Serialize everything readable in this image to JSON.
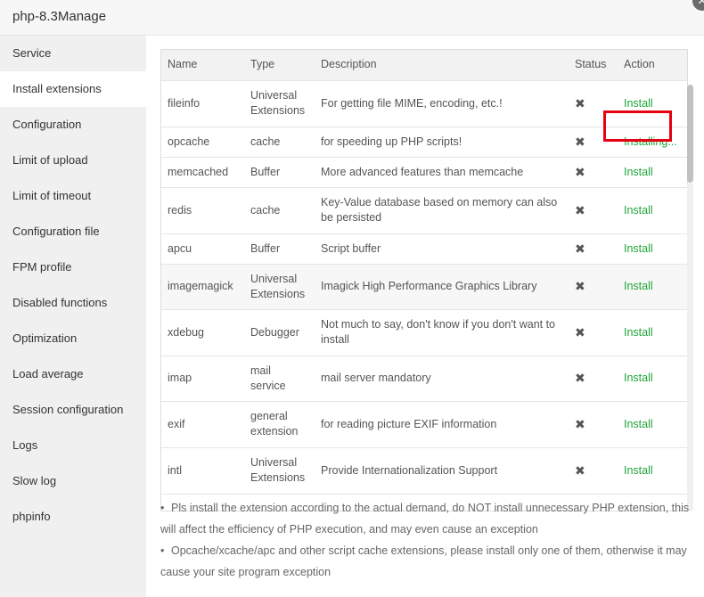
{
  "window": {
    "title": "php-8.3Manage",
    "close_label": "✕"
  },
  "sidebar": {
    "items": [
      {
        "label": "Service"
      },
      {
        "label": "Install extensions"
      },
      {
        "label": "Configuration"
      },
      {
        "label": "Limit of upload"
      },
      {
        "label": "Limit of timeout"
      },
      {
        "label": "Configuration file"
      },
      {
        "label": "FPM profile"
      },
      {
        "label": "Disabled functions"
      },
      {
        "label": "Optimization"
      },
      {
        "label": "Load average"
      },
      {
        "label": "Session configuration"
      },
      {
        "label": "Logs"
      },
      {
        "label": "Slow log"
      },
      {
        "label": "phpinfo"
      }
    ]
  },
  "table": {
    "headers": [
      "Name",
      "Type",
      "Description",
      "Status",
      "Action"
    ],
    "rows": [
      {
        "name": "fileinfo",
        "type": "Universal Extensions",
        "desc": "For getting file MIME, encoding, etc.!",
        "status": "✖",
        "action": "Install"
      },
      {
        "name": "opcache",
        "type": "cache",
        "desc": "for speeding up PHP scripts!",
        "status": "✖",
        "action": "Installing..."
      },
      {
        "name": "memcached",
        "type": "Buffer",
        "desc": "More advanced features than memcache",
        "status": "✖",
        "action": "Install"
      },
      {
        "name": "redis",
        "type": "cache",
        "desc": "Key-Value database based on memory can also be persisted",
        "status": "✖",
        "action": "Install"
      },
      {
        "name": "apcu",
        "type": "Buffer",
        "desc": "Script buffer",
        "status": "✖",
        "action": "Install"
      },
      {
        "name": "imagemagick",
        "type": "Universal Extensions",
        "desc": "Imagick High Performance Graphics Library",
        "status": "✖",
        "action": "Install"
      },
      {
        "name": "xdebug",
        "type": "Debugger",
        "desc": "Not much to say, don't know if you don't want to install",
        "status": "✖",
        "action": "Install"
      },
      {
        "name": "imap",
        "type": "mail service",
        "desc": "mail server mandatory",
        "status": "✖",
        "action": "Install"
      },
      {
        "name": "exif",
        "type": "general extension",
        "desc": "for reading picture EXIF information",
        "status": "✖",
        "action": "Install"
      },
      {
        "name": "intl",
        "type": "Universal Extensions",
        "desc": "Provide Internationalization Support",
        "status": "✖",
        "action": "Install"
      }
    ]
  },
  "notes": [
    "Pls install the extension according to the actual demand, do NOT install unnecessary PHP extension, this will affect the efficiency of PHP execution, and may even cause an exception",
    "Opcache/xcache/apc and other script cache extensions, please install only one of them, otherwise it may cause your site program exception"
  ],
  "colors": {
    "accent": "#20a53a",
    "highlight": "#e60012"
  }
}
